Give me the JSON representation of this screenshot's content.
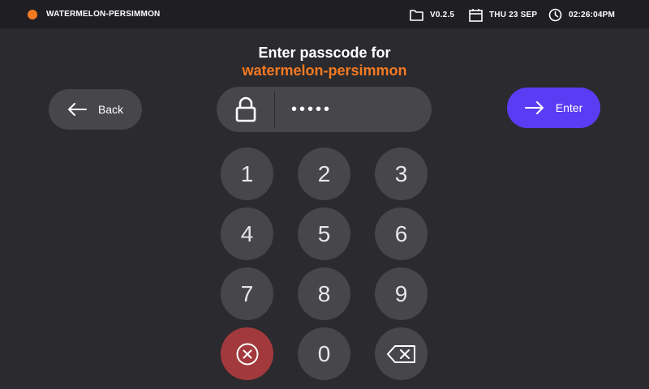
{
  "header": {
    "device_name": "WATERMELON-PERSIMMON",
    "status_color": "#f47a22",
    "version": "V0.2.5",
    "date": "THU 23 SEP",
    "time": "02:26:04PM",
    "icons": [
      "folder-icon",
      "calendar-icon",
      "clock-icon"
    ]
  },
  "prompt": {
    "line1": "Enter passcode for",
    "target": "watermelon-persimmon"
  },
  "back_button": {
    "label": "Back",
    "icon": "arrow-left-icon"
  },
  "enter_button": {
    "label": "Enter",
    "icon": "arrow-right-icon"
  },
  "passcode": {
    "masked_value": "•••••",
    "icon": "lock-icon"
  },
  "keypad": {
    "keys": [
      "1",
      "2",
      "3",
      "4",
      "5",
      "6",
      "7",
      "8",
      "9",
      "0"
    ],
    "clear_icon": "clear-circle-icon",
    "backspace_icon": "backspace-icon"
  },
  "colors": {
    "accent": "#5b3cf5",
    "brand": "#f47a22",
    "clear": "#a2393d",
    "background": "#2b2a2e",
    "header_bg": "#1f1e22",
    "button_bg": "#47464b"
  }
}
